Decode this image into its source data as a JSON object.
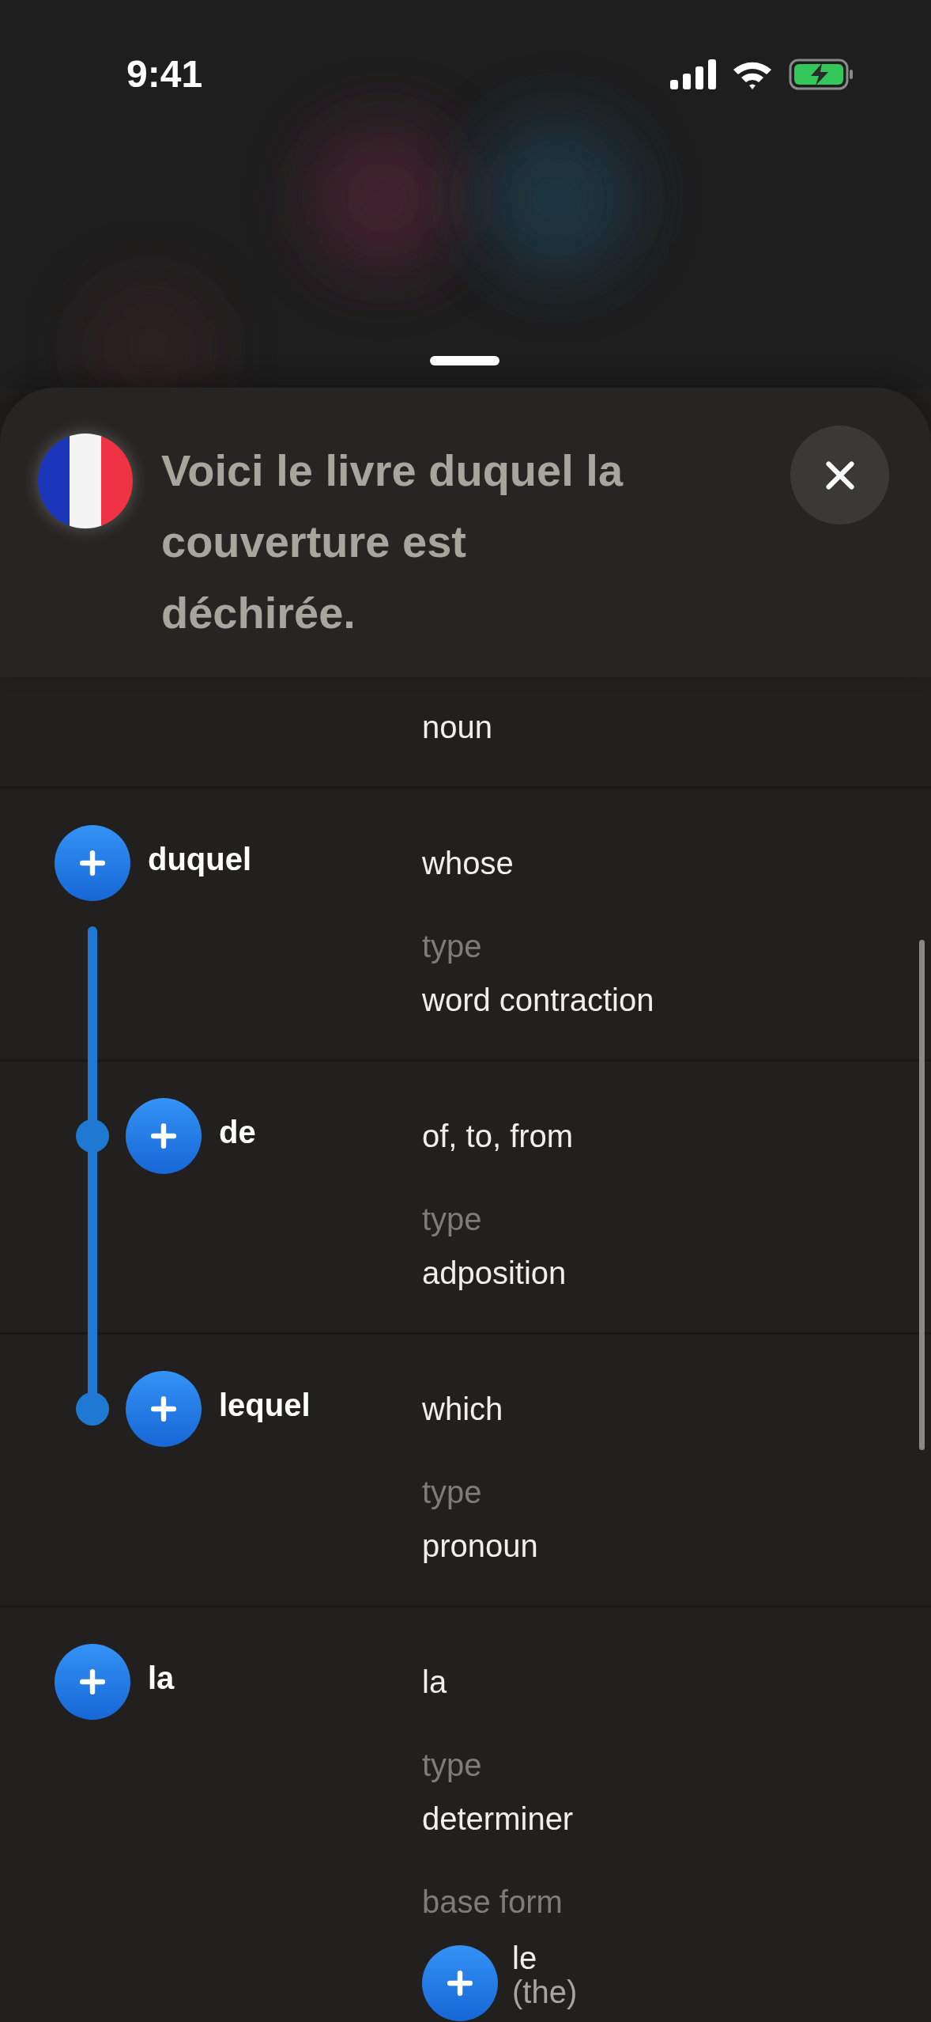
{
  "status_bar": {
    "time": "9:41"
  },
  "sentence": {
    "text": "Voici le livre duquel la couverture est déchirée."
  },
  "words": [
    {
      "fields": [
        {
          "kind": "text",
          "value": "noun"
        }
      ]
    },
    {
      "word": "duquel",
      "meaning": "whose",
      "fields": [
        {
          "kind": "text",
          "label": "type",
          "value": "word contraction"
        }
      ],
      "children": [
        {
          "word": "de",
          "meaning": "of, to, from",
          "fields": [
            {
              "kind": "text",
              "label": "type",
              "value": "adposition"
            }
          ]
        },
        {
          "word": "lequel",
          "meaning": "which",
          "fields": [
            {
              "kind": "text",
              "label": "type",
              "value": "pronoun"
            }
          ]
        }
      ]
    },
    {
      "word": "la",
      "meaning": "la",
      "fields": [
        {
          "kind": "text",
          "label": "type",
          "value": "determiner"
        },
        {
          "kind": "word",
          "label": "base form",
          "word": "le",
          "gloss": "(the)"
        }
      ]
    }
  ]
}
